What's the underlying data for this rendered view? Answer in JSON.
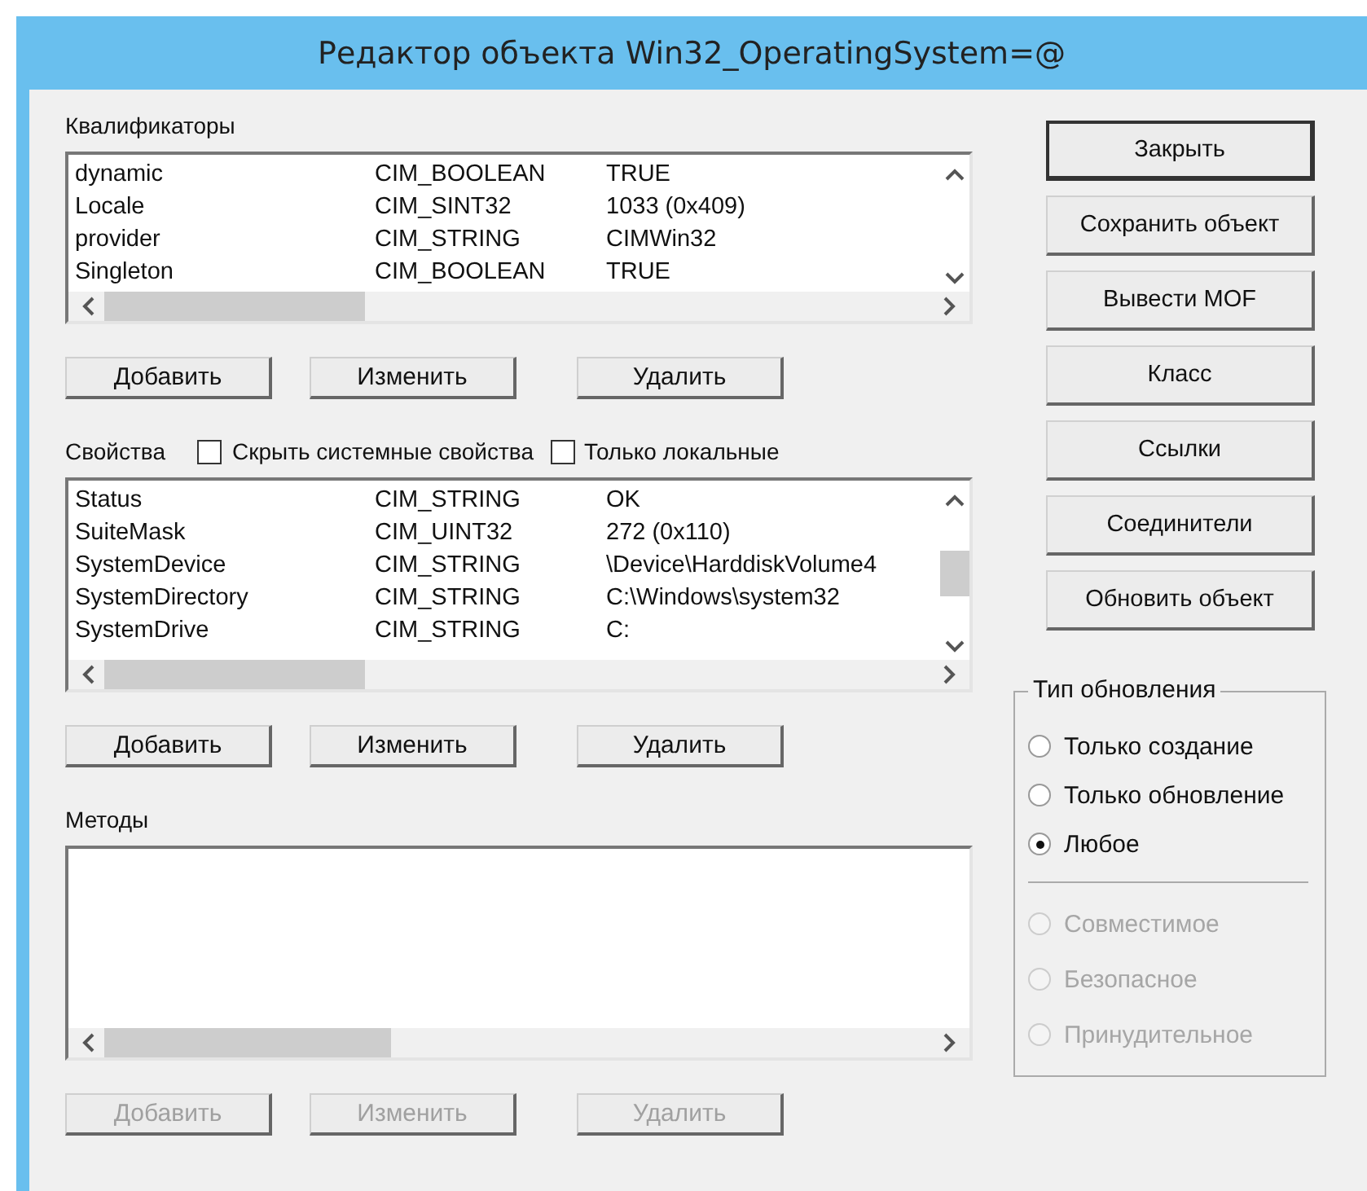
{
  "window": {
    "title": "Редактор объекта Win32_OperatingSystem=@"
  },
  "qualifiers": {
    "label": "Квалификаторы",
    "rows": [
      {
        "name": "dynamic",
        "type": "CIM_BOOLEAN",
        "value": "TRUE"
      },
      {
        "name": "Locale",
        "type": "CIM_SINT32",
        "value": "1033 (0x409)"
      },
      {
        "name": "provider",
        "type": "CIM_STRING",
        "value": "CIMWin32"
      },
      {
        "name": "Singleton",
        "type": "CIM_BOOLEAN",
        "value": "TRUE"
      }
    ],
    "buttons": [
      {
        "label": "Добавить",
        "disabled": false
      },
      {
        "label": "Изменить",
        "disabled": false
      },
      {
        "label": "Удалить",
        "disabled": false
      }
    ]
  },
  "properties": {
    "label": "Свойства",
    "options": [
      {
        "label": "Скрыть системные свойства",
        "checked": false
      },
      {
        "label": "Только локальные",
        "checked": false
      }
    ],
    "rows": [
      {
        "name": "Status",
        "type": "CIM_STRING",
        "value": "OK"
      },
      {
        "name": "SuiteMask",
        "type": "CIM_UINT32",
        "value": "272 (0x110)"
      },
      {
        "name": "SystemDevice",
        "type": "CIM_STRING",
        "value": "\\Device\\HarddiskVolume4"
      },
      {
        "name": "SystemDirectory",
        "type": "CIM_STRING",
        "value": "C:\\Windows\\system32"
      },
      {
        "name": "SystemDrive",
        "type": "CIM_STRING",
        "value": "C:"
      }
    ],
    "buttons": [
      {
        "label": "Добавить",
        "disabled": false
      },
      {
        "label": "Изменить",
        "disabled": false
      },
      {
        "label": "Удалить",
        "disabled": false
      }
    ]
  },
  "methods": {
    "label": "Методы",
    "buttons": [
      {
        "label": "Добавить",
        "disabled": true
      },
      {
        "label": "Изменить",
        "disabled": true
      },
      {
        "label": "Удалить",
        "disabled": true
      }
    ]
  },
  "actions": [
    {
      "label": "Закрыть",
      "default": true
    },
    {
      "label": "Сохранить объект",
      "default": false
    },
    {
      "label": "Вывести MOF",
      "default": false
    },
    {
      "label": "Класс",
      "default": false
    },
    {
      "label": "Ссылки",
      "default": false
    },
    {
      "label": "Соединители",
      "default": false
    },
    {
      "label": "Обновить объект",
      "default": false
    }
  ],
  "update_type": {
    "label": "Тип обновления",
    "modes": [
      {
        "label": "Только создание",
        "selected": false,
        "disabled": false
      },
      {
        "label": "Только обновление",
        "selected": false,
        "disabled": false
      },
      {
        "label": "Любое",
        "selected": true,
        "disabled": false
      }
    ],
    "flags": [
      {
        "label": "Совместимое",
        "selected": false,
        "disabled": true
      },
      {
        "label": "Безопасное",
        "selected": false,
        "disabled": true
      },
      {
        "label": "Принудительное",
        "selected": false,
        "disabled": true
      }
    ]
  }
}
